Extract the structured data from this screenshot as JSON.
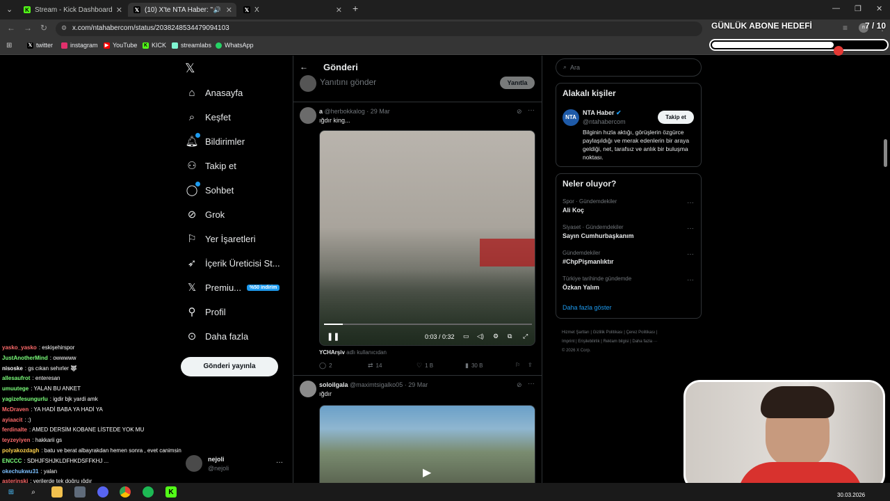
{
  "browser": {
    "tabs": [
      {
        "title": "Stream - Kick Dashboard"
      },
      {
        "title": "(10) X'te NTA Haber: \"🦁 Iğ..."
      },
      {
        "title": "X"
      }
    ],
    "url": "x.com/ntahabercom/status/2038248534479094103",
    "bookmarks": [
      "twitter",
      "instagram",
      "YouTube",
      "KICK",
      "streamlabs",
      "WhatsApp"
    ]
  },
  "overlay": {
    "goal_label": "GÜNLÜK ABONE HEDEFİ",
    "goal_count": "7 / 10",
    "goal_progress": 0.7
  },
  "nav": {
    "items": [
      {
        "label": "Anasayfa",
        "icon": "home-icon"
      },
      {
        "label": "Keşfet",
        "icon": "search-icon"
      },
      {
        "label": "Bildirimler",
        "icon": "bell-icon"
      },
      {
        "label": "Takip et",
        "icon": "person-add-icon"
      },
      {
        "label": "Sohbet",
        "icon": "chat-icon"
      },
      {
        "label": "Grok",
        "icon": "grok-icon"
      },
      {
        "label": "Yer İşaretleri",
        "icon": "bookmark-icon"
      },
      {
        "label": "İçerik Üreticisi St...",
        "icon": "rocket-icon"
      },
      {
        "label": "Premiu...",
        "icon": "x-logo-icon"
      },
      {
        "label": "Profil",
        "icon": "person-icon"
      },
      {
        "label": "Daha fazla",
        "icon": "more-circle-icon"
      }
    ],
    "premium_badge": "%50 indirim",
    "post_button": "Gönderi yayınla",
    "account": {
      "name": "nejoli",
      "handle": "@nejoli"
    }
  },
  "main": {
    "header": "Gönderi",
    "reply_placeholder": "Yanıtını gönder",
    "reply_button": "Yanıtla",
    "tweets": [
      {
        "name": "a",
        "handle": "@herbokkalog",
        "date": "· 29 Mar",
        "text": "ığdır king...",
        "video_time": "0:03 / 0:32",
        "video_progress": 0.09,
        "source_user": "YCHArşiv",
        "source_suffix": "adlı kullanıcıdan",
        "replies": "2",
        "reposts": "14",
        "likes": "1 B",
        "views": "30 B"
      },
      {
        "name": "soloilgala",
        "handle": "@maximtsigalko05",
        "date": "· 29 Mar",
        "text": "ığdır"
      }
    ]
  },
  "right": {
    "search_placeholder": "Ara",
    "related_title": "Alakalı kişiler",
    "related": {
      "name": "NTA Haber",
      "handle": "@ntahabercom",
      "follow": "Takip et",
      "bio": "Bilginin hızla aktığı, görüşlerin özgürce paylaşıldığı ve merak edenlerin bir araya geldiği, net, tarafsız ve anlık bir buluşma noktası."
    },
    "trends_title": "Neler oluyor?",
    "trends": [
      {
        "category": "Spor · Gündemdekiler",
        "name": "Ali Koç"
      },
      {
        "category": "Siyaset · Gündemdekiler",
        "name": "Sayın Cumhurbaşkanım"
      },
      {
        "category": "Gündemdekiler",
        "name": "#ChpPişmanlıktır"
      },
      {
        "category": "Türkiye tarihinde gündemde",
        "name": "Özkan Yalım"
      }
    ],
    "show_more": "Daha fazla göster",
    "footer_line1": "Hizmet Şartları  |  Gizlilik Politikası  |  Çerez Politikası  |",
    "footer_line2": "Imprint  |  Erişilebilirlik  |  Reklam bilgisi  |  Daha fazla ···",
    "footer_line3": "© 2026 X Corp."
  },
  "chat": [
    {
      "user": "yasko_yasko",
      "msg": ": eskişehirspor",
      "color": "#ff6b6b"
    },
    {
      "user": "JustAnotherMind",
      "msg": ": owwwww",
      "color": "#7cff7c"
    },
    {
      "user": "nisoske",
      "msg": ": gs cıkan sehırler 🐺",
      "color": "#ffffff"
    },
    {
      "user": "allesaufrot",
      "msg": ": enteresan",
      "color": "#7cff7c"
    },
    {
      "user": "umuutege",
      "msg": ": YALAN BU ANKET",
      "color": "#7cff7c"
    },
    {
      "user": "yagizefesungurlu",
      "msg": ": igdir bjk yardi amk",
      "color": "#7cff7c"
    },
    {
      "user": "McDraven",
      "msg": ": YA HADİ BABA YA HADİ YA",
      "color": "#ff6b6b"
    },
    {
      "user": "ayiaacit",
      "msg": ": ;)",
      "color": "#ff6b6b"
    },
    {
      "user": "ferdinalte",
      "msg": ": AMED DERSİM KOBANE LİSTEDE YOK MU",
      "color": "#ff6b6b"
    },
    {
      "user": "teyzeyiyen",
      "msg": ": hakkarii gs",
      "color": "#ff6b6b"
    },
    {
      "user": "polyakozdagh",
      "msg": ": batu ve berat albayrakdan hemen sonra , evet canimsin",
      "color": "#ffd24d"
    },
    {
      "user": "ENCCC",
      "msg": ": SDHJFSHJKLDFHKDSFFKHJ ...",
      "color": "#7cff7c"
    },
    {
      "user": "okechukwu31",
      "msg": ": yalan",
      "color": "#7cc0ff"
    },
    {
      "user": "asterinski",
      "msg": ": verilerde tek doğru ığdır",
      "color": "#ff6b6b"
    }
  ],
  "taskbar": {
    "date": "30.03.2026",
    "icons": [
      "windows-icon",
      "search-icon",
      "explorer-icon",
      "app-icon",
      "discord-icon",
      "chrome-icon",
      "spotify-icon",
      "kick-icon"
    ]
  }
}
